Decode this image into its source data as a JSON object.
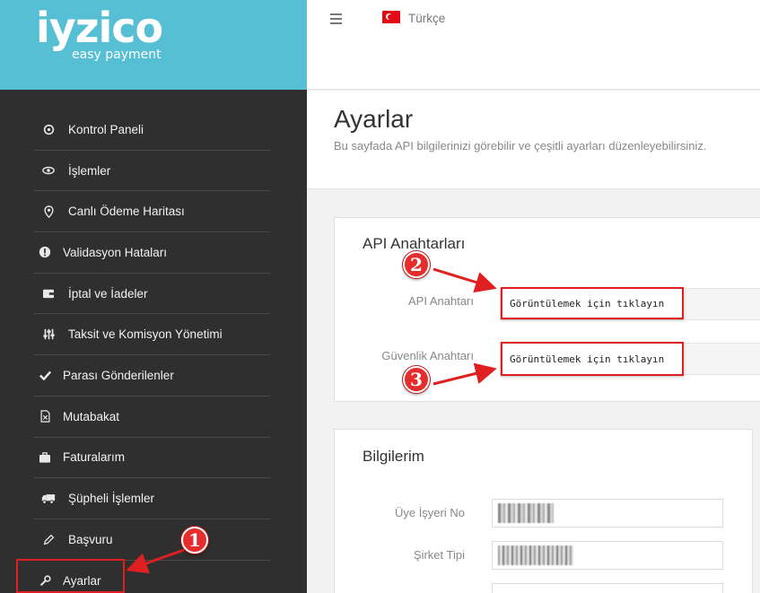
{
  "brand": {
    "name": "iyzico",
    "tagline": "easy payment"
  },
  "header": {
    "language": "Türkçe"
  },
  "sidebar": {
    "items": [
      {
        "label": "Kontrol Paneli",
        "icon": "dashboard-icon"
      },
      {
        "label": "İşlemler",
        "icon": "eye-icon"
      },
      {
        "label": "Canlı Ödeme Haritası",
        "icon": "map-pin-icon"
      },
      {
        "label": "Validasyon Hataları",
        "icon": "alert-icon"
      },
      {
        "label": "İptal ve İadeler",
        "icon": "wallet-icon"
      },
      {
        "label": "Taksit ve Komisyon Yönetimi",
        "icon": "sliders-icon"
      },
      {
        "label": "Parası Gönderilenler",
        "icon": "check-icon"
      },
      {
        "label": "Mutabakat",
        "icon": "file-excel-icon"
      },
      {
        "label": "Faturalarım",
        "icon": "briefcase-icon"
      },
      {
        "label": "Şüpheli İşlemler",
        "icon": "truck-icon"
      },
      {
        "label": "Başvuru",
        "icon": "pencil-icon"
      },
      {
        "label": "Ayarlar",
        "icon": "wrench-icon"
      }
    ]
  },
  "page": {
    "title": "Ayarlar",
    "subtitle": "Bu sayfada API bilgilerinizi görebilir ve çeşitli ayarları düzenleyebilirsiniz."
  },
  "api_panel": {
    "title": "API Anahtarları",
    "api_key_label": "API Anahtarı",
    "api_key_button": "Görüntülemek için tıklayın",
    "secret_key_label": "Güvenlik Anahtarı",
    "secret_key_button": "Görüntülemek için tıklayın"
  },
  "info_panel": {
    "title": "Bilgilerim",
    "merchant_no_label": "Üye İşyeri No",
    "company_type_label": "Şirket Tipi"
  },
  "annotations": {
    "step1": "1",
    "step2": "2",
    "step3": "3",
    "highlight_color": "#e02020"
  },
  "colors": {
    "brand": "#56bfd4",
    "sidebar_bg": "#2f2f2f"
  }
}
